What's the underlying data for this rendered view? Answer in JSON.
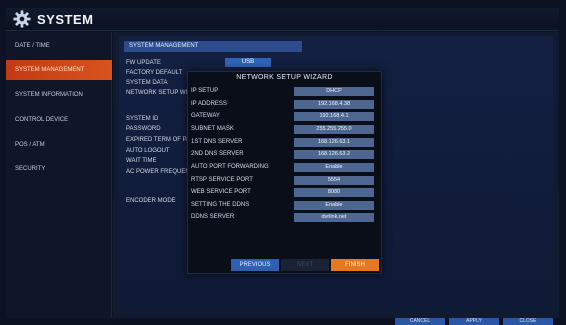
{
  "window": {
    "title": "SYSTEM"
  },
  "sidebar": {
    "items": [
      {
        "label": "DATE / TIME",
        "active": false
      },
      {
        "label": "SYSTEM MANAGEMENT",
        "active": true
      },
      {
        "label": "SYSTEM INFORMATION",
        "active": false
      },
      {
        "label": "CONTROL DEVICE",
        "active": false
      },
      {
        "label": "POS / ATM",
        "active": false
      },
      {
        "label": "SECURITY",
        "active": false
      }
    ]
  },
  "main": {
    "section_title": "SYSTEM MANAGEMENT",
    "fw_update_button": "USB",
    "settings": [
      "FW UPDATE",
      "FACTORY DEFAULT",
      "SYSTEM DATA",
      "NETWORK SETUP WIZARD",
      "SYSTEM ID",
      "PASSWORD",
      "EXPIRED TERM OF PASSW",
      "AUTO LOGOUT",
      "WAIT TIME",
      "AC POWER FREQUENCY",
      "ENCODER MODE"
    ]
  },
  "dialog": {
    "title": "NETWORK SETUP WIZARD",
    "fields": [
      {
        "label": "IP SETUP",
        "value": "DHCP"
      },
      {
        "label": "IP ADDRESS",
        "value": "192.168.4.38"
      },
      {
        "label": "GATEWAY",
        "value": "192.168.4.1"
      },
      {
        "label": "SUBNET MASK",
        "value": "255.255.255.0"
      },
      {
        "label": "1ST DNS SERVER",
        "value": "168.126.63.1"
      },
      {
        "label": "2ND DNS SERVER",
        "value": "168.126.63.2"
      },
      {
        "label": "AUTO PORT FORWARDING",
        "value": "Enable"
      },
      {
        "label": "RTSP SERVICE PORT",
        "value": "5554"
      },
      {
        "label": "WEB SERVICE PORT",
        "value": "8080"
      },
      {
        "label": "SETTING THE DDNS",
        "value": "Enable"
      },
      {
        "label": "DDNS SERVER",
        "value": "dvrlink.net"
      }
    ],
    "buttons": {
      "previous": "PREVIOUS",
      "next": "NEXT",
      "finish": "FINISH"
    }
  },
  "footer": {
    "cancel": "CANCEL",
    "apply": "APPLY",
    "close": "CLOSE"
  },
  "colors": {
    "accent": "#d9531e",
    "primary": "#2e63b8",
    "finish": "#e8781f",
    "field": "#4e6791"
  }
}
